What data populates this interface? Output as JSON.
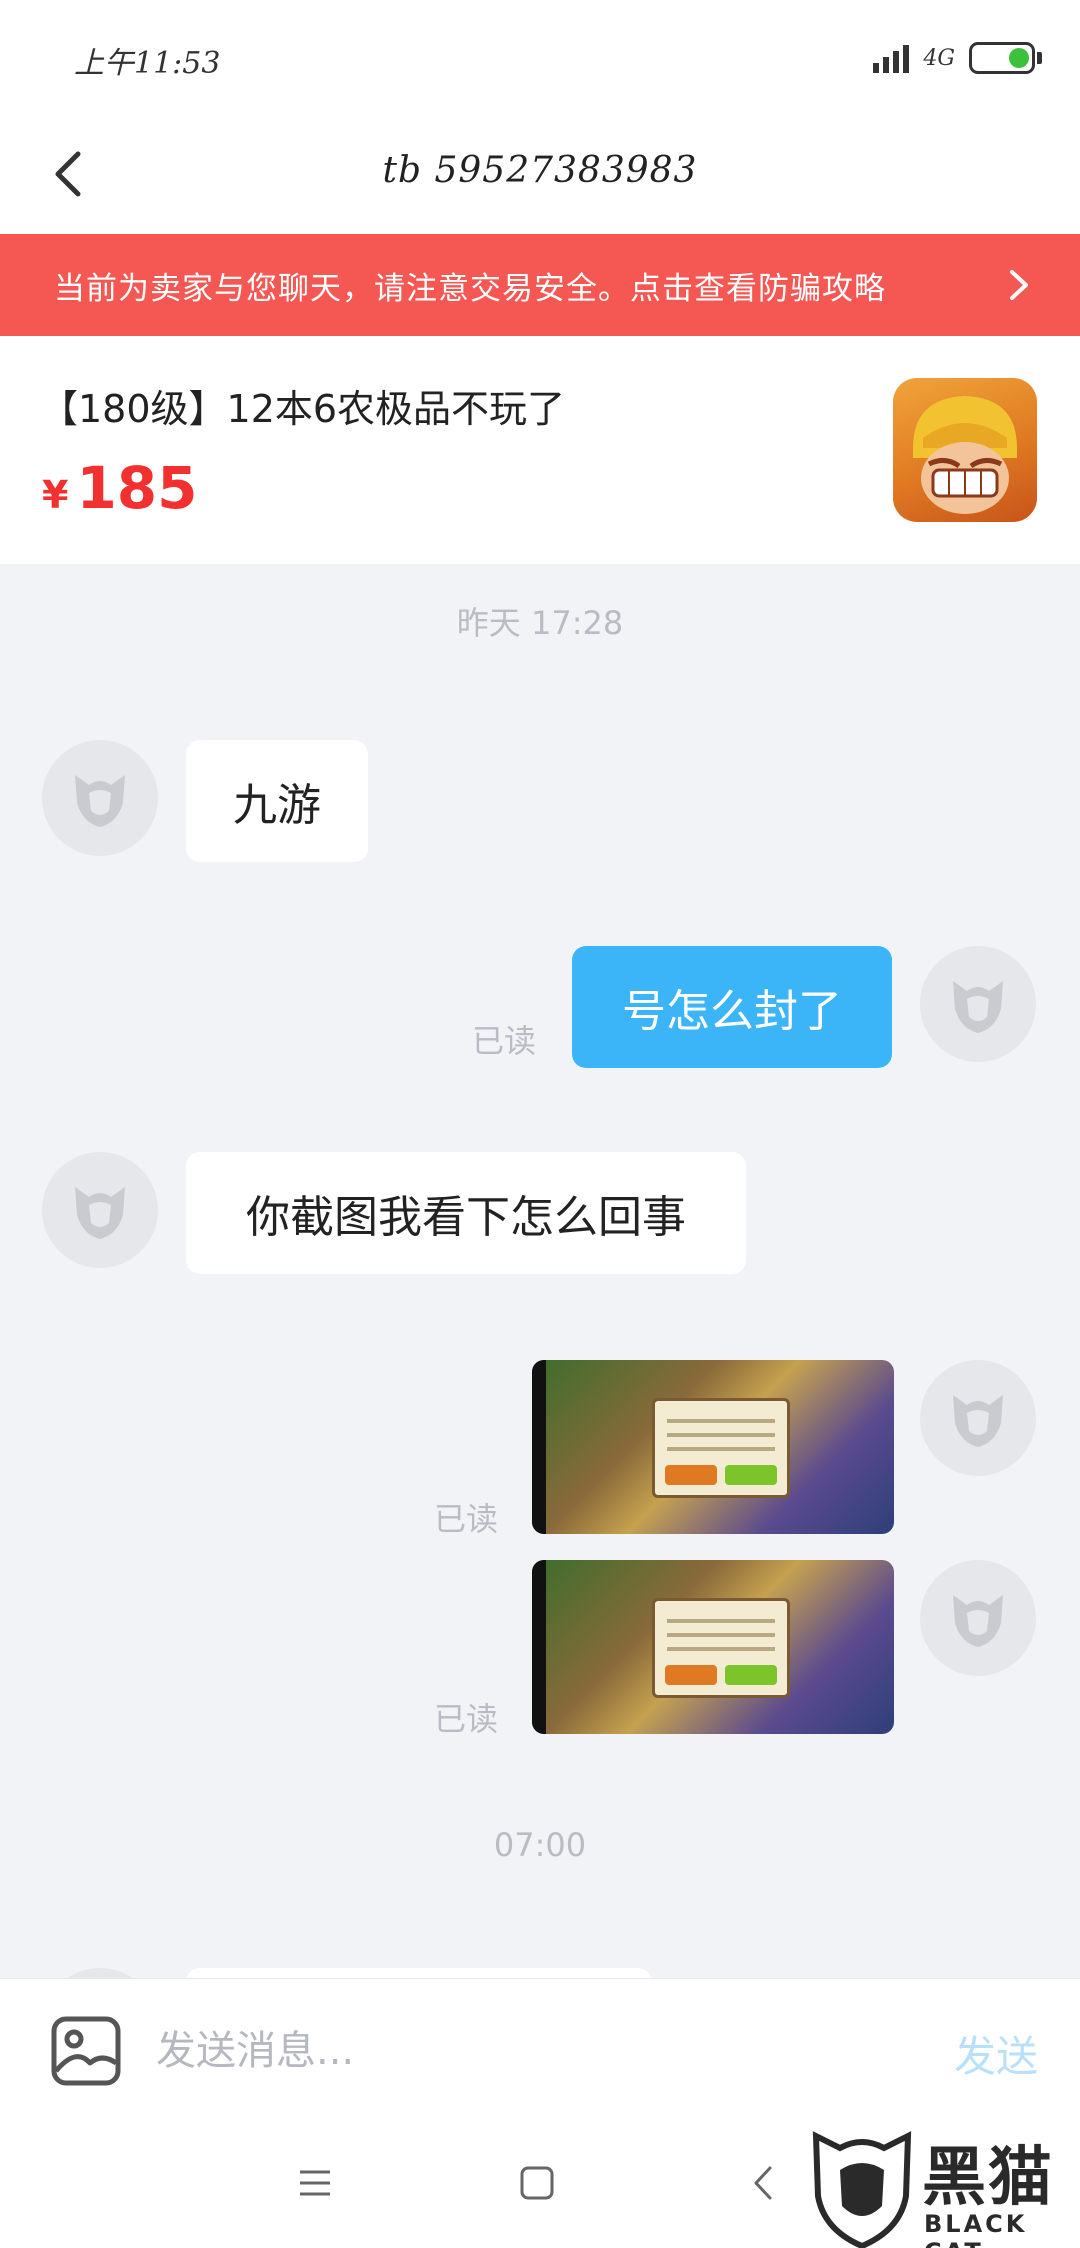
{
  "status_bar": {
    "time": "上午11:53",
    "network": "4G"
  },
  "header": {
    "title": "tb 59527383983"
  },
  "banner": {
    "text": "当前为卖家与您聊天，请注意交易安全。点击查看防骗攻略"
  },
  "product": {
    "title": "【180级】12本6农极品不玩了",
    "price_symbol": "¥",
    "price": "185"
  },
  "chat": {
    "timestamps": [
      "昨天 17:28",
      "07:00"
    ],
    "messages": [
      {
        "side": "left",
        "text": "九游"
      },
      {
        "side": "right",
        "text": "号怎么封了",
        "status": "已读"
      },
      {
        "side": "left",
        "text": "你截图我看下怎么回事"
      },
      {
        "side": "right",
        "type": "image",
        "status": "已读"
      },
      {
        "side": "right",
        "type": "image",
        "status": "已读"
      }
    ]
  },
  "input_bar": {
    "placeholder": "发送消息...",
    "send_label": "发送"
  },
  "watermark": {
    "text": "黑猫",
    "sub": "BLACK CAT"
  },
  "colors": {
    "banner_bg": "#f55753",
    "price": "#f23030",
    "bubble_right": "#3bb4f8",
    "chat_bg": "#f2f3f7"
  }
}
